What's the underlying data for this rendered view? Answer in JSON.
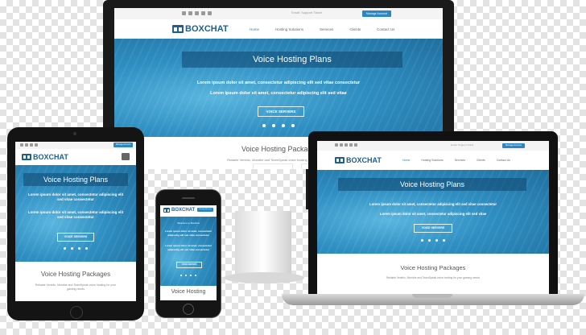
{
  "brand": {
    "name": "BOXCHAT"
  },
  "nav": {
    "items": [
      "Home",
      "Hosting Solutions",
      "Services",
      "Clients",
      "Contact Us"
    ]
  },
  "topbar": {
    "login": "Manage Account",
    "support": "Email: Support Ticket"
  },
  "hero": {
    "title": "Voice Hosting Plans",
    "line1": "Lorem ipsum dolor sit amet, consectetur adipiscing elit sed vitae consectetur",
    "line2": "Lorem ipsum dolor sit amet, consectetur adipiscing elit sed vitae",
    "button": "VOICE SERVERS"
  },
  "tablet": {
    "hero_line1": "Lorem ipsum dolor sit amet, consectetur adipiscing elit sed vitae consectetur",
    "hero_line2": "Lorem ipsum dolor sit amet, consectetur adipiscing elit sed vitae consectetur"
  },
  "phone": {
    "welcome": "Welcome to Boxchat",
    "line1": "Lorem ipsum dolor sit amet, consectetur adipiscing elit sed vitae consectetur",
    "line2": "Lorem ipsum dolor sit amet, consectetur adipiscing elit sed vitae consectetur",
    "section": "Voice Hosting"
  },
  "packages": {
    "title": "Voice Hosting Packages",
    "subtitle": "Reliable Ventrilo, Mumble and TeamSpeak voice hosting for your gaming needs",
    "title_cut": "Voice Hosting Packa",
    "subtitle_cut": "Reliable Ventrilo, Mumble and TeamSpeak voice hosting"
  },
  "colors": {
    "accent": "#2e86c1",
    "brand": "#1e5f8f",
    "device_frame": "#1b1b1b",
    "hero": "#2f8fc2"
  }
}
